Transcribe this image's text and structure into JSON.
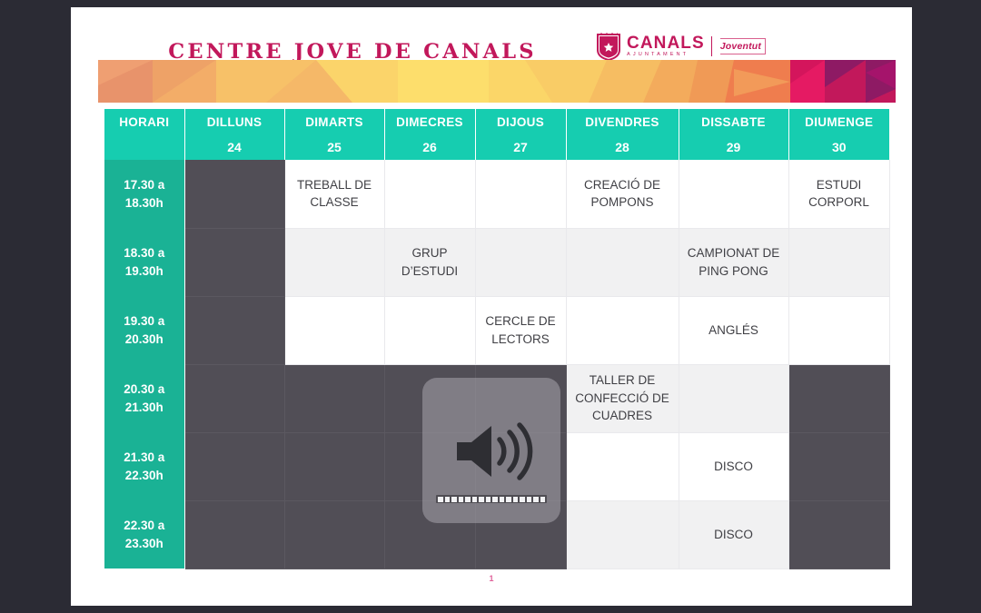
{
  "document": {
    "title": "CENTRE  JOVE  DE  CANALS",
    "page_number": "1"
  },
  "logo": {
    "crest_name": "canals-coat-of-arms",
    "name": "CANALS",
    "subtitle": "AJUNTAMENT",
    "department": "Joventut"
  },
  "banner": {
    "name": "low-poly-gradient-banner",
    "colors": [
      "#e8936b",
      "#f5b86b",
      "#fbd46a",
      "#fad15f",
      "#f08a52",
      "#e51a63",
      "#c2185b",
      "#8e1a64",
      "#a5146b"
    ]
  },
  "theme": {
    "teal_header": "#16cdb0",
    "teal_time": "#1ab295",
    "dark_cell": "#514e56",
    "shade_cell": "#f1f1f2",
    "white_cell": "#ffffff",
    "pink": "#c2185b"
  },
  "schedule": {
    "corner_label": "HORARI",
    "days": [
      {
        "name": "DILLUNS",
        "date": "24"
      },
      {
        "name": "DIMARTS",
        "date": "25"
      },
      {
        "name": "DIMECRES",
        "date": "26"
      },
      {
        "name": "DIJOUS",
        "date": "27"
      },
      {
        "name": "DIVENDRES",
        "date": "28"
      },
      {
        "name": "DISSABTE",
        "date": "29"
      },
      {
        "name": "DIUMENGE",
        "date": "30"
      }
    ],
    "rows": [
      {
        "time": "17.30 a\n18.30h",
        "time_line1": "17.30 a",
        "time_line2": "18.30h",
        "cells": [
          {
            "text": "",
            "state": "dark"
          },
          {
            "text": "TREBALL DE CLASSE",
            "state": "white"
          },
          {
            "text": "",
            "state": "white"
          },
          {
            "text": "",
            "state": "white"
          },
          {
            "text": "CREACIÓ DE POMPONS",
            "state": "white"
          },
          {
            "text": "",
            "state": "white"
          },
          {
            "text": "ESTUDI CORPORL",
            "state": "white"
          }
        ]
      },
      {
        "time_line1": "18.30 a",
        "time_line2": "19.30h",
        "cells": [
          {
            "text": "",
            "state": "dark"
          },
          {
            "text": "",
            "state": "shade"
          },
          {
            "text": "GRUP D’ESTUDI",
            "state": "shade"
          },
          {
            "text": "",
            "state": "shade"
          },
          {
            "text": "",
            "state": "shade"
          },
          {
            "text": "CAMPIONAT DE PING PONG",
            "state": "shade"
          },
          {
            "text": "",
            "state": "shade"
          }
        ]
      },
      {
        "time_line1": "19.30 a",
        "time_line2": "20.30h",
        "cells": [
          {
            "text": "",
            "state": "dark"
          },
          {
            "text": "",
            "state": "white"
          },
          {
            "text": "",
            "state": "white"
          },
          {
            "text": "CERCLE DE LECTORS",
            "state": "white"
          },
          {
            "text": "",
            "state": "white"
          },
          {
            "text": "ANGLÉS",
            "state": "white"
          },
          {
            "text": "",
            "state": "white"
          }
        ]
      },
      {
        "time_line1": "20.30 a",
        "time_line2": "21.30h",
        "cells": [
          {
            "text": "",
            "state": "dark"
          },
          {
            "text": "",
            "state": "dark"
          },
          {
            "text": "",
            "state": "dark"
          },
          {
            "text": "",
            "state": "dark"
          },
          {
            "text": "TALLER DE CONFECCIÓ DE CUADRES",
            "state": "shade"
          },
          {
            "text": "",
            "state": "shade"
          },
          {
            "text": "",
            "state": "dark"
          }
        ]
      },
      {
        "time_line1": "21.30 a",
        "time_line2": "22.30h",
        "cells": [
          {
            "text": "",
            "state": "dark"
          },
          {
            "text": "",
            "state": "dark"
          },
          {
            "text": "",
            "state": "dark"
          },
          {
            "text": "",
            "state": "dark"
          },
          {
            "text": "",
            "state": "white"
          },
          {
            "text": "DISCO",
            "state": "white"
          },
          {
            "text": "",
            "state": "dark"
          }
        ]
      },
      {
        "time_line1": "22.30 a",
        "time_line2": "23.30h",
        "cells": [
          {
            "text": "",
            "state": "dark"
          },
          {
            "text": "",
            "state": "dark"
          },
          {
            "text": "",
            "state": "dark"
          },
          {
            "text": "",
            "state": "dark"
          },
          {
            "text": "",
            "state": "shade"
          },
          {
            "text": "DISCO",
            "state": "shade"
          },
          {
            "text": "",
            "state": "dark"
          }
        ]
      }
    ]
  },
  "volume_osd": {
    "icon_name": "speaker-volume-icon",
    "segments_total": 16,
    "segments_filled": 16
  }
}
